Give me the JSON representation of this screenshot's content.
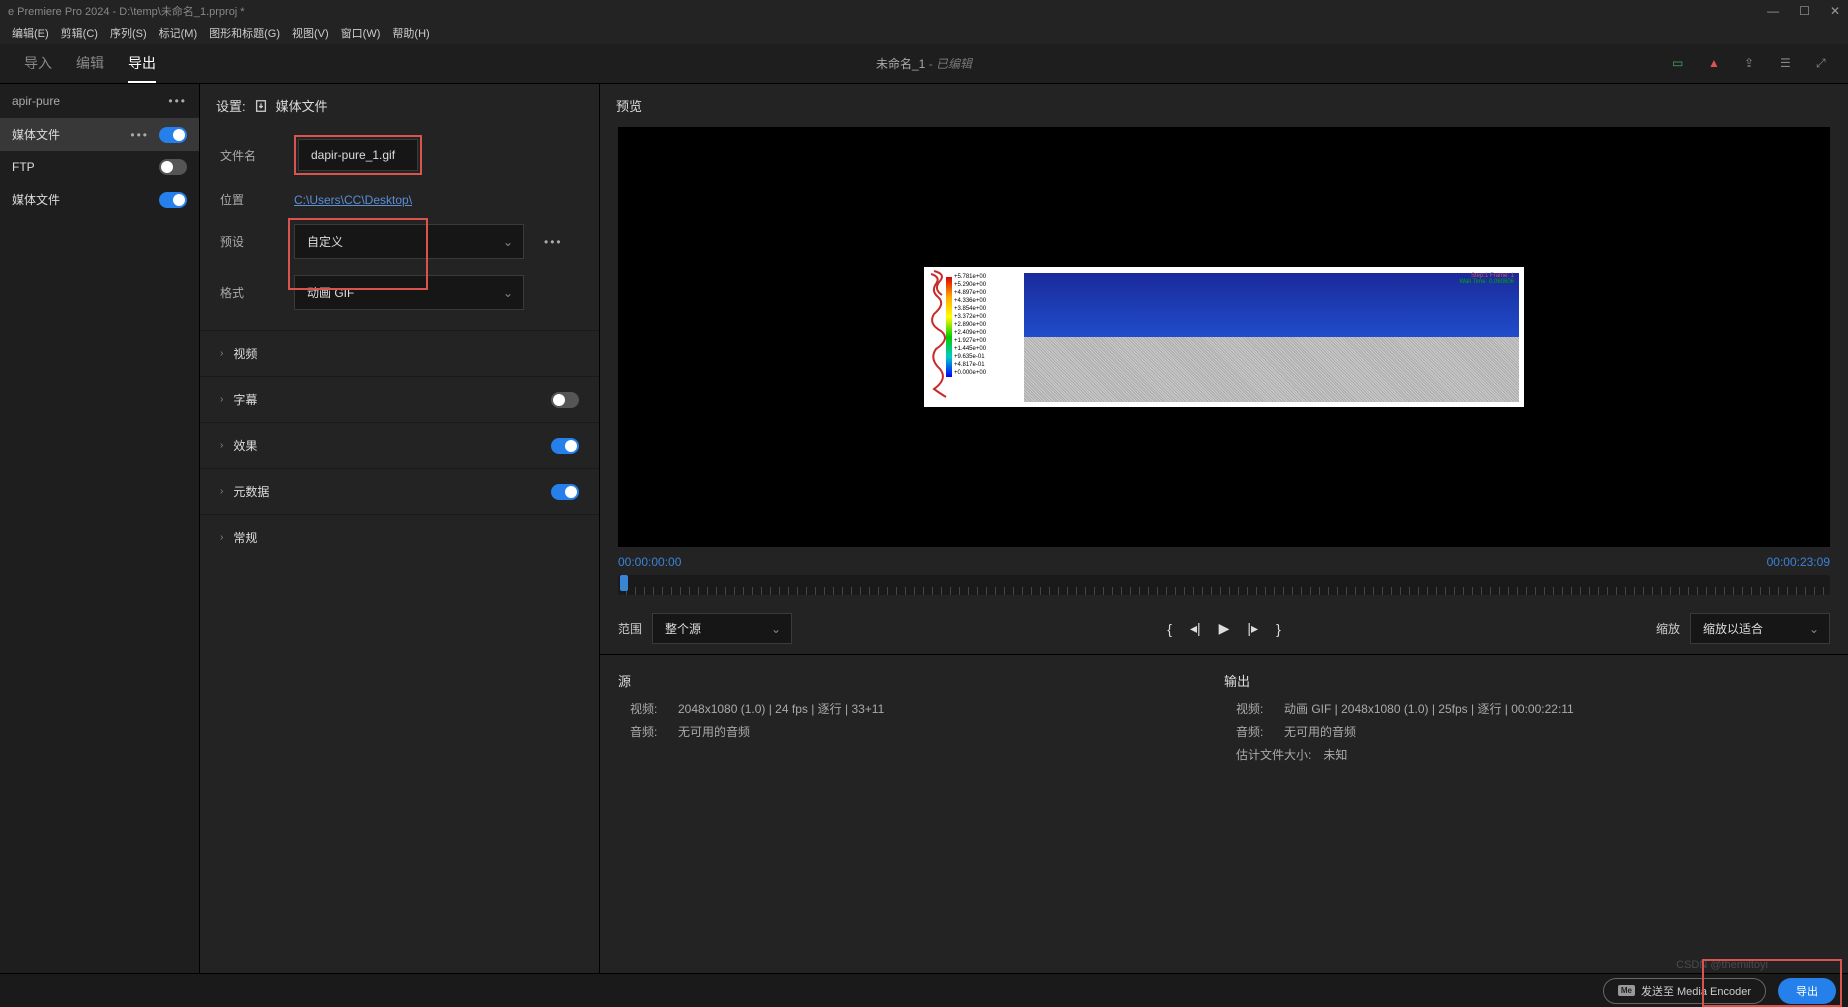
{
  "titleBar": "e Premiere Pro 2024 - D:\\temp\\未命名_1.prproj *",
  "menu": {
    "edit": "编辑(E)",
    "clip": "剪辑(C)",
    "sequence": "序列(S)",
    "marker": "标记(M)",
    "graphics": "图形和标题(G)",
    "view": "视图(V)",
    "window": "窗口(W)",
    "help": "帮助(H)"
  },
  "modeTabs": {
    "import": "导入",
    "edit": "编辑",
    "export": "导出"
  },
  "projectLabel": "未命名_1",
  "projectEdited": "- 已编辑",
  "sidebar": {
    "headerText": "apir-pure",
    "items": [
      {
        "label": "媒体文件",
        "active": true,
        "toggled": true,
        "hasMore": true
      },
      {
        "label": "FTP",
        "active": false,
        "toggled": false,
        "hasMore": false
      },
      {
        "label": "媒体文件",
        "active": false,
        "toggled": true,
        "hasMore": false
      }
    ]
  },
  "settings": {
    "header": "设置:",
    "headerMedia": "媒体文件",
    "filenameLabel": "文件名",
    "filename": "dapir-pure_1.gif",
    "locationLabel": "位置",
    "location": "C:\\Users\\CC\\Desktop\\",
    "presetLabel": "预设",
    "preset": "自定义",
    "formatLabel": "格式",
    "format": "动画 GIF",
    "sections": [
      {
        "label": "视频",
        "toggle": null
      },
      {
        "label": "字幕",
        "toggle": false
      },
      {
        "label": "效果",
        "toggle": true
      },
      {
        "label": "元数据",
        "toggle": true
      },
      {
        "label": "常规",
        "toggle": null
      }
    ]
  },
  "preview": {
    "header": "预览",
    "startTime": "00:00:00:00",
    "endTime": "00:00:23:09",
    "rangeLabel": "范围",
    "rangeValue": "整个源",
    "scaleLabel": "缩放",
    "scaleValue": "缩放以适合",
    "frameInfo1": "Step:1  Frame: 1",
    "frameInfo2": "Wall Time: 0.060606",
    "legendValues": [
      "+5.781e+00",
      "+5.290e+00",
      "+4.897e+00",
      "+4.336e+00",
      "+3.854e+00",
      "+3.372e+00",
      "+2.890e+00",
      "+2.409e+00",
      "+1.927e+00",
      "+1.445e+00",
      "+9.635e-01",
      "+4.817e-01",
      "+0.000e+00"
    ]
  },
  "source": {
    "title": "源",
    "videoLabel": "视频:",
    "video": "2048x1080 (1.0) | 24 fps | 逐行 | 33+11",
    "audioLabel": "音频:",
    "audio": "无可用的音频"
  },
  "output": {
    "title": "输出",
    "videoLabel": "视频:",
    "video": "动画 GIF | 2048x1080 (1.0) | 25fps | 逐行 | 00:00:22:11",
    "audioLabel": "音频:",
    "audio": "无可用的音频",
    "estimateLabel": "估计文件大小:",
    "estimate": "未知"
  },
  "bottomBar": {
    "meBadge": "Me",
    "sendEncoder": "发送至 Media Encoder",
    "export": "导出"
  },
  "watermark": "CSDN @themiltoyi"
}
